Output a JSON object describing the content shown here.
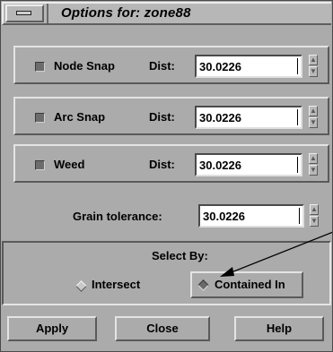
{
  "window": {
    "title": "Options for: zone88"
  },
  "snap_rows": [
    {
      "label": "Node Snap",
      "dist_label": "Dist:",
      "value": "30.0226"
    },
    {
      "label": "Arc Snap",
      "dist_label": "Dist:",
      "value": "30.0226"
    },
    {
      "label": "Weed",
      "dist_label": "Dist:",
      "value": "30.0226"
    }
  ],
  "grain": {
    "label": "Grain tolerance:",
    "value": "30.0226"
  },
  "select_by": {
    "label": "Select By:",
    "options": [
      {
        "label": "Intersect",
        "selected": false
      },
      {
        "label": "Contained In",
        "selected": true
      }
    ]
  },
  "buttons": {
    "apply": "Apply",
    "close": "Close",
    "help": "Help"
  },
  "icons": {
    "window_menu": "window-menu-icon",
    "toggle": "toggle-indicator-icon",
    "radio": "diamond-radio-icon",
    "spinner": "spinner-arrows-icon",
    "annotation": "annotation-arrow-icon"
  },
  "colors": {
    "panel": "#ababab",
    "field": "#ffffff",
    "text": "#000000",
    "arrow": "#000000"
  }
}
